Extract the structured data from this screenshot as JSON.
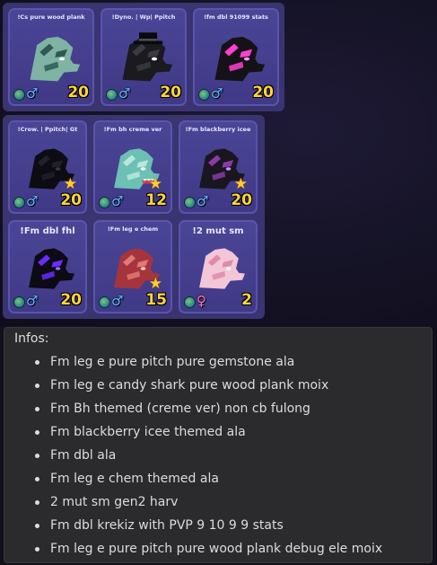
{
  "colors": {
    "card_bg": "#4b4596",
    "panel_bg": "#3a3470",
    "age_yellow": "#ffd43b",
    "male_blue": "#5fb8ff",
    "female_pink": "#ff74c8",
    "info_bg": "#2b2a2d"
  },
  "pets": [
    {
      "name": "!Cs pure wood plank",
      "age": "20",
      "gender": "male",
      "star": false,
      "dragon": "teal-camo",
      "big_title": false
    },
    {
      "name": "!Dyno. | Wp| Ppitch",
      "age": "20",
      "gender": "male",
      "star": false,
      "dragon": "black-tophat",
      "big_title": false
    },
    {
      "name": "!fm dbl 91099 stats",
      "age": "20",
      "gender": "male",
      "star": false,
      "dragon": "pink-black",
      "big_title": false
    },
    {
      "name": "!Crow. | Ppitch| Gt",
      "age": "20",
      "gender": "male",
      "star": true,
      "dragon": "black",
      "big_title": false
    },
    {
      "name": "!Fm bh creme ver",
      "age": "12",
      "gender": "male",
      "star": true,
      "dragon": "teal-shark",
      "big_title": false
    },
    {
      "name": "!Fm blackberry icee",
      "age": "20",
      "gender": "male",
      "star": true,
      "dragon": "blackberry",
      "big_title": false
    },
    {
      "name": "!Fm dbl fhl",
      "age": "20",
      "gender": "male",
      "star": false,
      "dragon": "purple-black",
      "big_title": true
    },
    {
      "name": "!Fm leg e chem",
      "age": "15",
      "gender": "male",
      "star": true,
      "dragon": "red",
      "big_title": false
    },
    {
      "name": "!2 mut sm",
      "age": "2",
      "gender": "female",
      "star": false,
      "dragon": "pink-white",
      "big_title": true
    }
  ],
  "info": {
    "title": "Infos:",
    "items": [
      "Fm leg e pure pitch pure gemstone ala",
      "Fm leg e candy shark pure wood plank moix",
      "Fm Bh themed (creme ver) non cb fulong",
      "Fm blackberry icee themed ala",
      "Fm dbl ala",
      "Fm leg e chem themed ala",
      "2 mut sm gen2 harv",
      "Fm dbl krekiz with PVP 9 10 9 9 stats",
      "Fm leg e pure pitch pure wood plank debug ele moix"
    ]
  }
}
